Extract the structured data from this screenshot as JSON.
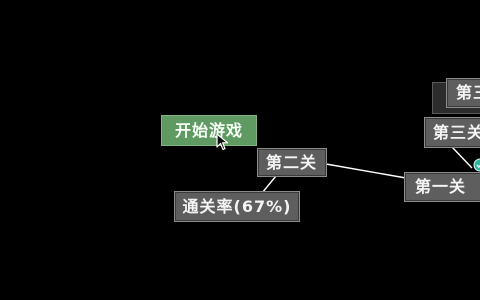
{
  "menu": {
    "start_game_label": "开始游戏"
  },
  "levels": {
    "level_1_label": "第一关",
    "level_2_label": "第二关",
    "level_3_label": "第三关",
    "level_top_label": "第三"
  },
  "stats": {
    "clear_rate_label": "通关率",
    "clear_rate_value": "(67%)"
  },
  "colors": {
    "background": "#000000",
    "node_grey": "#5e5e5e",
    "start_green": "#5f9a62",
    "link_line": "#ffffff",
    "marker_teal": "#2fb39a"
  },
  "icons": {
    "cursor": "pointer-cursor-icon",
    "marker": "level-marker-icon"
  }
}
